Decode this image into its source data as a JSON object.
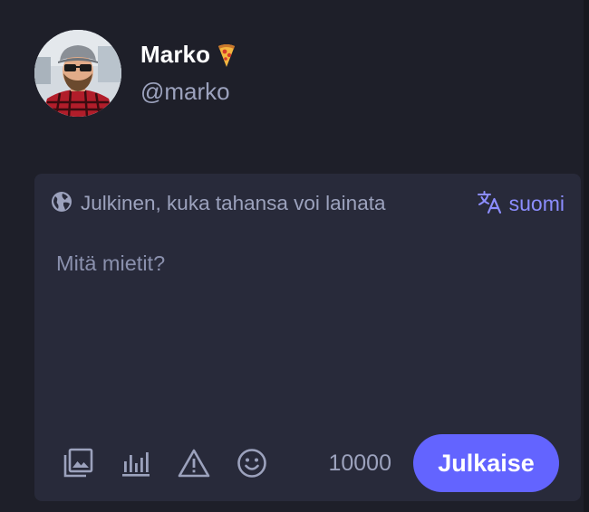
{
  "account": {
    "display_name": "Marko",
    "display_name_emoji": "pizza-emoji",
    "handle": "@marko",
    "avatar_icon": "user-avatar-photo"
  },
  "composer": {
    "visibility": {
      "icon": "globe-icon",
      "label": "Julkinen, kuka tahansa voi lainata"
    },
    "language": {
      "icon": "translate-icon",
      "label": "suomi"
    },
    "placeholder": "Mitä mietit?",
    "value": "",
    "tools": [
      {
        "name": "media",
        "icon": "image-icon"
      },
      {
        "name": "poll",
        "icon": "poll-icon"
      },
      {
        "name": "content-warning",
        "icon": "warning-icon"
      },
      {
        "name": "emoji",
        "icon": "emoji-icon"
      }
    ],
    "char_counter": "10000",
    "publish_label": "Julkaise"
  },
  "colors": {
    "background": "#1e1f29",
    "panel": "#282a3a",
    "accent": "#6364ff",
    "accent_text": "#8c8dff",
    "muted_text": "#9ca2bd"
  }
}
